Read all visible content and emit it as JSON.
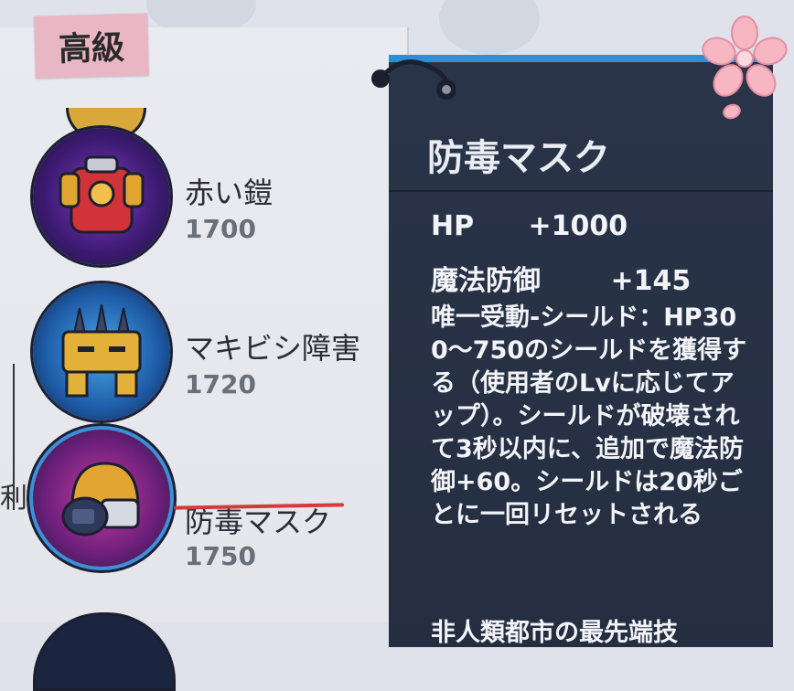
{
  "tier": {
    "label": "高級"
  },
  "items": [
    {
      "name": "赤い鎧",
      "cost": "1700",
      "icon": "red-armor-icon"
    },
    {
      "name": "マキビシ障害",
      "cost": "1720",
      "icon": "spiked-barrier-icon"
    },
    {
      "name": "防毒マスク",
      "cost": "1750",
      "icon": "gas-mask-icon",
      "selected": true
    }
  ],
  "left_fragment": {
    "char": "利"
  },
  "tooltip": {
    "title": "防毒マスク",
    "stats": [
      {
        "label": "HP",
        "value": "+1000"
      },
      {
        "label": "魔法防御",
        "value": "+145"
      }
    ],
    "description": "唯一受動-シールド：HP300～750のシールドを獲得する（使用者のLvに応じてアップ）。シールドが破壊されて3秒以内に、追加で魔法防御+60。シールドは20秒ごとに一回リセットされる",
    "cut_line": "非人類都市の最先端技"
  },
  "colors": {
    "tooltip_bg": "#2a3448",
    "tooltip_accent": "#2e8ed6",
    "tier_tag": "#e9b6c6",
    "selection_underline": "#d43a3a"
  }
}
